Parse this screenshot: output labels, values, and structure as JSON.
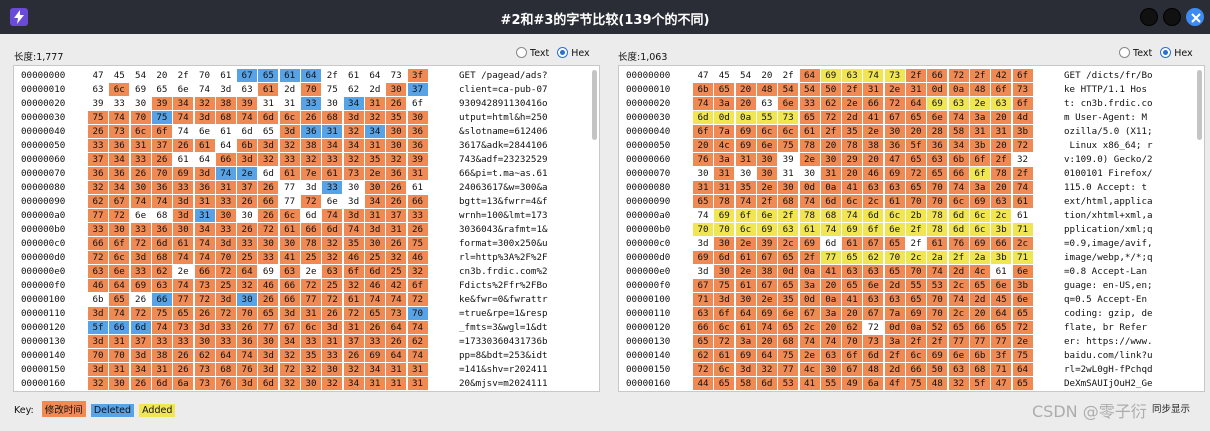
{
  "window": {
    "title": "#2和#3的字节比较(139个的不同)"
  },
  "left": {
    "length_label": "长度:1,777",
    "view_options": [
      "Text",
      "Hex"
    ],
    "selected_view": "Hex",
    "rows": [
      {
        "addr": "00000000",
        "bytes": [
          "47",
          "45",
          "54",
          "20",
          "2f",
          "70",
          "61",
          "67",
          "65",
          "61",
          "64",
          "2f",
          "61",
          "64",
          "73",
          "3f"
        ],
        "diff": "0000000dddd0000m",
        "ascii": "GET /pagead/ads?"
      },
      {
        "addr": "00000010",
        "bytes": [
          "63",
          "6c",
          "69",
          "65",
          "6e",
          "74",
          "3d",
          "63",
          "61",
          "2d",
          "70",
          "75",
          "62",
          "2d",
          "30",
          "37"
        ],
        "diff": "0m000000m0m000md",
        "ascii": "client=ca-pub-07"
      },
      {
        "addr": "00000020",
        "bytes": [
          "39",
          "33",
          "30",
          "39",
          "34",
          "32",
          "38",
          "39",
          "31",
          "31",
          "33",
          "30",
          "34",
          "31",
          "26",
          "6f"
        ],
        "diff": "000mmmmm00d0dmm0",
        "ascii": "930942891130416o"
      },
      {
        "addr": "00000030",
        "bytes": [
          "75",
          "74",
          "70",
          "75",
          "74",
          "3d",
          "68",
          "74",
          "6d",
          "6c",
          "26",
          "68",
          "3d",
          "32",
          "35",
          "30"
        ],
        "diff": "mmmdmmmmmmmmmmmm",
        "ascii": "utput=html&h=250"
      },
      {
        "addr": "00000040",
        "bytes": [
          "26",
          "73",
          "6c",
          "6f",
          "74",
          "6e",
          "61",
          "6d",
          "65",
          "3d",
          "36",
          "31",
          "32",
          "34",
          "30",
          "36"
        ],
        "diff": "mmmm00000mddmdmm",
        "ascii": "&slotname=612406"
      },
      {
        "addr": "00000050",
        "bytes": [
          "33",
          "36",
          "31",
          "37",
          "26",
          "61",
          "64",
          "6b",
          "3d",
          "32",
          "38",
          "34",
          "34",
          "31",
          "30",
          "36"
        ],
        "diff": "mmmmmm0mmmmmmmmm",
        "ascii": "3617&adk=2844106"
      },
      {
        "addr": "00000060",
        "bytes": [
          "37",
          "34",
          "33",
          "26",
          "61",
          "64",
          "66",
          "3d",
          "32",
          "33",
          "32",
          "33",
          "32",
          "35",
          "32",
          "39"
        ],
        "diff": "mmmm00mmmmmmmmmm",
        "ascii": "743&adf=23232529"
      },
      {
        "addr": "00000070",
        "bytes": [
          "36",
          "36",
          "26",
          "70",
          "69",
          "3d",
          "74",
          "2e",
          "6d",
          "61",
          "7e",
          "61",
          "73",
          "2e",
          "36",
          "31"
        ],
        "diff": "mmmmmmdd0mmmmmmm",
        "ascii": "66&pi=t.ma~as.61"
      },
      {
        "addr": "00000080",
        "bytes": [
          "32",
          "34",
          "30",
          "36",
          "33",
          "36",
          "31",
          "37",
          "26",
          "77",
          "3d",
          "33",
          "30",
          "30",
          "26",
          "61"
        ],
        "diff": "mmmmmmmmm00d0mm0",
        "ascii": "24063617&w=300&a"
      },
      {
        "addr": "00000090",
        "bytes": [
          "62",
          "67",
          "74",
          "74",
          "3d",
          "31",
          "33",
          "26",
          "66",
          "77",
          "72",
          "6e",
          "3d",
          "34",
          "26",
          "66"
        ],
        "diff": "mmmmmmmmm0m00mmm",
        "ascii": "bgtt=13&fwrr=4&f"
      },
      {
        "addr": "000000a0",
        "bytes": [
          "77",
          "72",
          "6e",
          "68",
          "3d",
          "31",
          "30",
          "30",
          "26",
          "6c",
          "6d",
          "74",
          "3d",
          "31",
          "37",
          "33"
        ],
        "diff": "mm00mdm0mm0mmmmm",
        "ascii": "wrnh=100&lmt=173"
      },
      {
        "addr": "000000b0",
        "bytes": [
          "33",
          "30",
          "33",
          "36",
          "30",
          "34",
          "33",
          "26",
          "72",
          "61",
          "66",
          "6d",
          "74",
          "3d",
          "31",
          "26"
        ],
        "diff": "mmmmmmmmmmmmmmmm",
        "ascii": "3036043&rafmt=1&"
      },
      {
        "addr": "000000c0",
        "bytes": [
          "66",
          "6f",
          "72",
          "6d",
          "61",
          "74",
          "3d",
          "33",
          "30",
          "30",
          "78",
          "32",
          "35",
          "30",
          "26",
          "75"
        ],
        "diff": "mmmmmmmmmmmmmmmm",
        "ascii": "format=300x250&u"
      },
      {
        "addr": "000000d0",
        "bytes": [
          "72",
          "6c",
          "3d",
          "68",
          "74",
          "74",
          "70",
          "25",
          "33",
          "41",
          "25",
          "32",
          "46",
          "25",
          "32",
          "46"
        ],
        "diff": "mmmmmmmmmmmmmmmm",
        "ascii": "rl=http%3A%2F%2F"
      },
      {
        "addr": "000000e0",
        "bytes": [
          "63",
          "6e",
          "33",
          "62",
          "2e",
          "66",
          "72",
          "64",
          "69",
          "63",
          "2e",
          "63",
          "6f",
          "6d",
          "25",
          "32"
        ],
        "diff": "mmmm0mmm0m0mmmmm",
        "ascii": "cn3b.frdic.com%2"
      },
      {
        "addr": "000000f0",
        "bytes": [
          "46",
          "64",
          "69",
          "63",
          "74",
          "73",
          "25",
          "32",
          "46",
          "66",
          "72",
          "25",
          "32",
          "46",
          "42",
          "6f"
        ],
        "diff": "mmmmmmmmmmmmmmmm",
        "ascii": "Fdicts%2Ffr%2FBo"
      },
      {
        "addr": "00000100",
        "bytes": [
          "6b",
          "65",
          "26",
          "66",
          "77",
          "72",
          "3d",
          "30",
          "26",
          "66",
          "77",
          "72",
          "61",
          "74",
          "74",
          "72"
        ],
        "diff": "0m0dmmmdmmmmmmmm",
        "ascii": "ke&fwr=0&fwrattr"
      },
      {
        "addr": "00000110",
        "bytes": [
          "3d",
          "74",
          "72",
          "75",
          "65",
          "26",
          "72",
          "70",
          "65",
          "3d",
          "31",
          "26",
          "72",
          "65",
          "73",
          "70"
        ],
        "diff": "mmmmmmmmmmmmmmmd",
        "ascii": "=true&rpe=1&resp"
      },
      {
        "addr": "00000120",
        "bytes": [
          "5f",
          "66",
          "6d",
          "74",
          "73",
          "3d",
          "33",
          "26",
          "77",
          "67",
          "6c",
          "3d",
          "31",
          "26",
          "64",
          "74"
        ],
        "diff": "dddmmmmmmmmmmmmm",
        "ascii": "_fmts=3&wgl=1&dt"
      },
      {
        "addr": "00000130",
        "bytes": [
          "3d",
          "31",
          "37",
          "33",
          "33",
          "30",
          "33",
          "36",
          "30",
          "34",
          "33",
          "31",
          "37",
          "33",
          "26",
          "62"
        ],
        "diff": "mmmmmmmmmmmmmmmm",
        "ascii": "=17330360431736b"
      },
      {
        "addr": "00000140",
        "bytes": [
          "70",
          "70",
          "3d",
          "38",
          "26",
          "62",
          "64",
          "74",
          "3d",
          "32",
          "35",
          "33",
          "26",
          "69",
          "64",
          "74"
        ],
        "diff": "mmmmmmmmmmmmmmmm",
        "ascii": "pp=8&bdt=253&idt"
      },
      {
        "addr": "00000150",
        "bytes": [
          "3d",
          "31",
          "34",
          "31",
          "26",
          "73",
          "68",
          "76",
          "3d",
          "72",
          "32",
          "30",
          "32",
          "34",
          "31",
          "31"
        ],
        "diff": "mmmmmmmmmmmmmmmm",
        "ascii": "=141&shv=r202411"
      },
      {
        "addr": "00000160",
        "bytes": [
          "32",
          "30",
          "26",
          "6d",
          "6a",
          "73",
          "76",
          "3d",
          "6d",
          "32",
          "30",
          "32",
          "34",
          "31",
          "31",
          "31"
        ],
        "diff": "mmmmmmmmmmmmmmmm",
        "ascii": "20&mjsv=m2024111"
      }
    ]
  },
  "right": {
    "length_label": "长度:1,063",
    "view_options": [
      "Text",
      "Hex"
    ],
    "selected_view": "Hex",
    "rows": [
      {
        "addr": "00000000",
        "bytes": [
          "47",
          "45",
          "54",
          "20",
          "2f",
          "64",
          "69",
          "63",
          "74",
          "73",
          "2f",
          "66",
          "72",
          "2f",
          "42",
          "6f"
        ],
        "diff": "00000maaaammmmmm",
        "ascii": "GET /dicts/fr/Bo"
      },
      {
        "addr": "00000010",
        "bytes": [
          "6b",
          "65",
          "20",
          "48",
          "54",
          "54",
          "50",
          "2f",
          "31",
          "2e",
          "31",
          "0d",
          "0a",
          "48",
          "6f",
          "73"
        ],
        "diff": "mmmmmmmmmmmmmmmm",
        "ascii": "ke HTTP/1.1 Hos"
      },
      {
        "addr": "00000020",
        "bytes": [
          "74",
          "3a",
          "20",
          "63",
          "6e",
          "33",
          "62",
          "2e",
          "66",
          "72",
          "64",
          "69",
          "63",
          "2e",
          "63",
          "6f"
        ],
        "diff": "mmm0mmmmmmmaaaam",
        "ascii": "t: cn3b.frdic.co"
      },
      {
        "addr": "00000030",
        "bytes": [
          "6d",
          "0d",
          "0a",
          "55",
          "73",
          "65",
          "72",
          "2d",
          "41",
          "67",
          "65",
          "6e",
          "74",
          "3a",
          "20",
          "4d"
        ],
        "diff": "aaaaammmmmmmmmmm",
        "ascii": "m User-Agent: M"
      },
      {
        "addr": "00000040",
        "bytes": [
          "6f",
          "7a",
          "69",
          "6c",
          "6c",
          "61",
          "2f",
          "35",
          "2e",
          "30",
          "20",
          "28",
          "58",
          "31",
          "31",
          "3b"
        ],
        "diff": "mmmmmmmmmmmmmmmm",
        "ascii": "ozilla/5.0 (X11;"
      },
      {
        "addr": "00000050",
        "bytes": [
          "20",
          "4c",
          "69",
          "6e",
          "75",
          "78",
          "20",
          "78",
          "38",
          "36",
          "5f",
          "36",
          "34",
          "3b",
          "20",
          "72"
        ],
        "diff": "mmmmmmmmmmmmmmmm",
        "ascii": " Linux x86_64; r"
      },
      {
        "addr": "00000060",
        "bytes": [
          "76",
          "3a",
          "31",
          "30",
          "39",
          "2e",
          "30",
          "29",
          "20",
          "47",
          "65",
          "63",
          "6b",
          "6f",
          "2f",
          "32"
        ],
        "diff": "mmmm0mmmmmmmmmm0",
        "ascii": "v:109.0) Gecko/2"
      },
      {
        "addr": "00000070",
        "bytes": [
          "30",
          "31",
          "30",
          "30",
          "31",
          "30",
          "31",
          "20",
          "46",
          "69",
          "72",
          "65",
          "66",
          "6f",
          "78",
          "2f"
        ],
        "diff": "0m0m00mmmmmmmamm",
        "ascii": "0100101 Firefox/"
      },
      {
        "addr": "00000080",
        "bytes": [
          "31",
          "31",
          "35",
          "2e",
          "30",
          "0d",
          "0a",
          "41",
          "63",
          "63",
          "65",
          "70",
          "74",
          "3a",
          "20",
          "74"
        ],
        "diff": "mmmmmmmmmmmmmmmm",
        "ascii": "115.0 Accept: t"
      },
      {
        "addr": "00000090",
        "bytes": [
          "65",
          "78",
          "74",
          "2f",
          "68",
          "74",
          "6d",
          "6c",
          "2c",
          "61",
          "70",
          "70",
          "6c",
          "69",
          "63",
          "61"
        ],
        "diff": "mmmmmmmmmmmmmmmm",
        "ascii": "ext/html,applica"
      },
      {
        "addr": "000000a0",
        "bytes": [
          "74",
          "69",
          "6f",
          "6e",
          "2f",
          "78",
          "68",
          "74",
          "6d",
          "6c",
          "2b",
          "78",
          "6d",
          "6c",
          "2c",
          "61"
        ],
        "diff": "0aaaaaaaaaaaaaa0",
        "ascii": "tion/xhtml+xml,a"
      },
      {
        "addr": "000000b0",
        "bytes": [
          "70",
          "70",
          "6c",
          "69",
          "63",
          "61",
          "74",
          "69",
          "6f",
          "6e",
          "2f",
          "78",
          "6d",
          "6c",
          "3b",
          "71"
        ],
        "diff": "aaaaaaaaaaaaaaaa",
        "ascii": "pplication/xml;q"
      },
      {
        "addr": "000000c0",
        "bytes": [
          "3d",
          "30",
          "2e",
          "39",
          "2c",
          "69",
          "6d",
          "61",
          "67",
          "65",
          "2f",
          "61",
          "76",
          "69",
          "66",
          "2c"
        ],
        "diff": "0mmmmm0mmm0mmmmm",
        "ascii": "=0.9,image/avif,"
      },
      {
        "addr": "000000d0",
        "bytes": [
          "69",
          "6d",
          "61",
          "67",
          "65",
          "2f",
          "77",
          "65",
          "62",
          "70",
          "2c",
          "2a",
          "2f",
          "2a",
          "3b",
          "71"
        ],
        "diff": "mmmmmmaaaaaaaaaa",
        "ascii": "image/webp,*/*;q"
      },
      {
        "addr": "000000e0",
        "bytes": [
          "3d",
          "30",
          "2e",
          "38",
          "0d",
          "0a",
          "41",
          "63",
          "63",
          "65",
          "70",
          "74",
          "2d",
          "4c",
          "61",
          "6e"
        ],
        "diff": "0mmmmmmmmmmmmm0m",
        "ascii": "=0.8 Accept-Lan"
      },
      {
        "addr": "000000f0",
        "bytes": [
          "67",
          "75",
          "61",
          "67",
          "65",
          "3a",
          "20",
          "65",
          "6e",
          "2d",
          "55",
          "53",
          "2c",
          "65",
          "6e",
          "3b"
        ],
        "diff": "mmmmmmmmmmmmmmmm",
        "ascii": "guage: en-US,en;"
      },
      {
        "addr": "00000100",
        "bytes": [
          "71",
          "3d",
          "30",
          "2e",
          "35",
          "0d",
          "0a",
          "41",
          "63",
          "63",
          "65",
          "70",
          "74",
          "2d",
          "45",
          "6e"
        ],
        "diff": "mmmmmmmmmmmmmmmm",
        "ascii": "q=0.5 Accept-En"
      },
      {
        "addr": "00000110",
        "bytes": [
          "63",
          "6f",
          "64",
          "69",
          "6e",
          "67",
          "3a",
          "20",
          "67",
          "7a",
          "69",
          "70",
          "2c",
          "20",
          "64",
          "65"
        ],
        "diff": "mmmmmmmmmmmmmmmm",
        "ascii": "coding: gzip, de"
      },
      {
        "addr": "00000120",
        "bytes": [
          "66",
          "6c",
          "61",
          "74",
          "65",
          "2c",
          "20",
          "62",
          "72",
          "0d",
          "0a",
          "52",
          "65",
          "66",
          "65",
          "72"
        ],
        "diff": "mmmmmmmm0mmmmmmm",
        "ascii": "flate, br Refer"
      },
      {
        "addr": "00000130",
        "bytes": [
          "65",
          "72",
          "3a",
          "20",
          "68",
          "74",
          "74",
          "70",
          "73",
          "3a",
          "2f",
          "2f",
          "77",
          "77",
          "77",
          "2e"
        ],
        "diff": "mmmmmmmmmmmmmmmm",
        "ascii": "er: https://www."
      },
      {
        "addr": "00000140",
        "bytes": [
          "62",
          "61",
          "69",
          "64",
          "75",
          "2e",
          "63",
          "6f",
          "6d",
          "2f",
          "6c",
          "69",
          "6e",
          "6b",
          "3f",
          "75"
        ],
        "diff": "mmmmmmmmmmmmmmmm",
        "ascii": "baidu.com/link?u"
      },
      {
        "addr": "00000150",
        "bytes": [
          "72",
          "6c",
          "3d",
          "32",
          "77",
          "4c",
          "30",
          "67",
          "48",
          "2d",
          "66",
          "50",
          "63",
          "68",
          "71",
          "64"
        ],
        "diff": "mmmmmmmmmmmmmmmm",
        "ascii": "rl=2wL0gH-fPchqd"
      },
      {
        "addr": "00000160",
        "bytes": [
          "44",
          "65",
          "58",
          "6d",
          "53",
          "41",
          "55",
          "49",
          "6a",
          "4f",
          "75",
          "48",
          "32",
          "5f",
          "47",
          "65"
        ],
        "diff": "mmmmmmmmmmmmmmmm",
        "ascii": "DeXmSAUIjOuH2_Ge"
      }
    ]
  },
  "legend": {
    "label": "Key:",
    "modified": "修改时间",
    "deleted": "Deleted",
    "added": "Added"
  },
  "footer": {
    "sync_label": "同步显示"
  },
  "watermark": "CSDN @零子衍",
  "colors": {
    "modified": "#ef8a55",
    "deleted": "#58a2e6",
    "added": "#f0e553",
    "titlebar": "#2a2d36"
  }
}
